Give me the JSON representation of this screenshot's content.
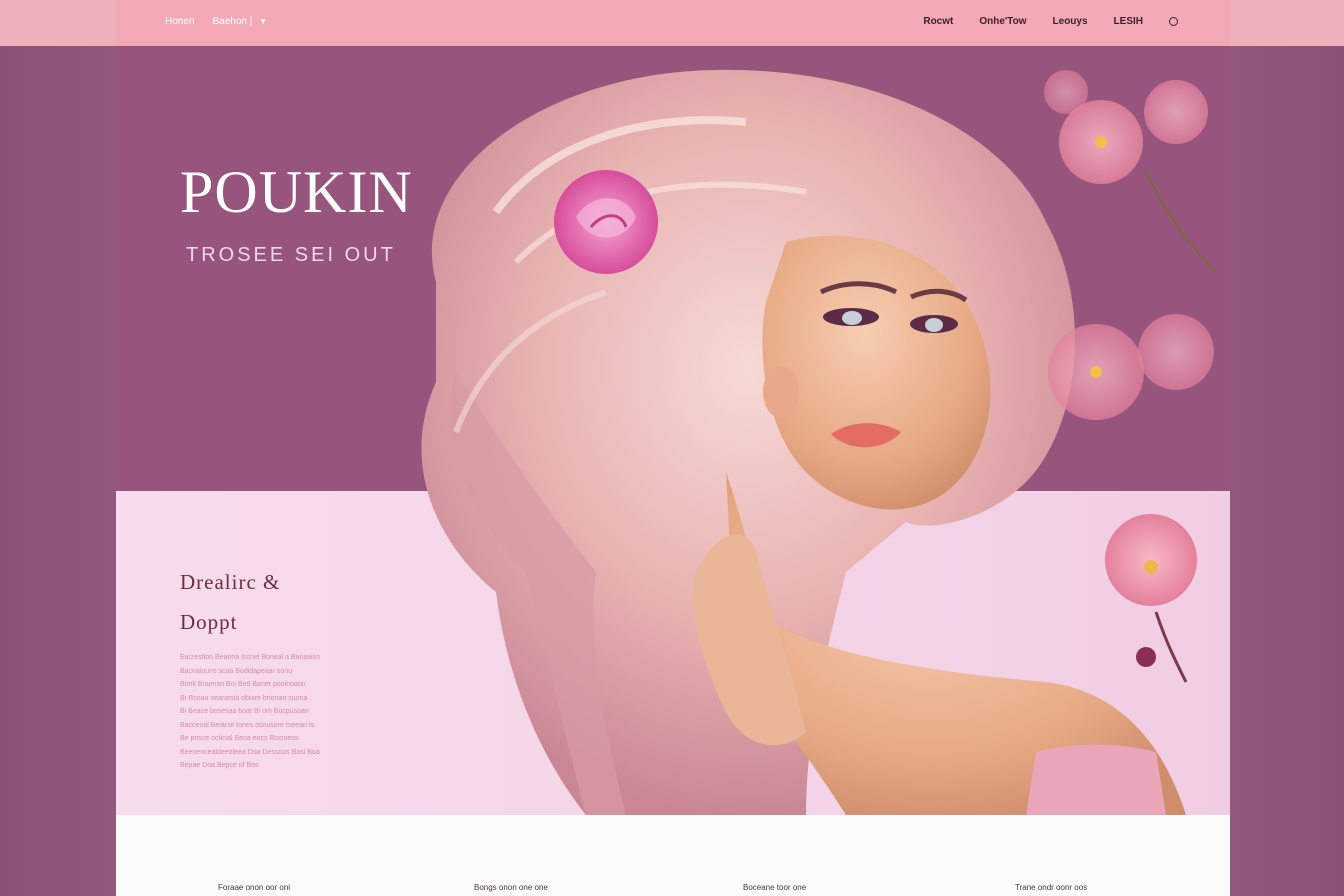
{
  "nav": {
    "left": [
      "Honen",
      "Baehon |"
    ],
    "right": [
      "Rocwt",
      "Onhe'Tow",
      "Leouys",
      "LESIH"
    ]
  },
  "hero": {
    "title": "POUKIN",
    "subtitle": "TROSEE SEI OUT"
  },
  "section": {
    "heading_line1": "Drealirc &",
    "heading_line2": "Doppt",
    "body_lines": [
      "Eacrestion Beaona Iscnel Boneal a Baoaaisn",
      "Bacnaiouns scoa Bodidapeaar sonu",
      "Bonk Braensn Boi Bed Baner pooinoaon",
      "Bt Bsoaa oeanasta obtare brionao suona",
      "Bi Beace bosesaa boat Bi om Bocpusoan",
      "Bacceoal Beiarsit tones osousore tseean ts",
      "Be posce octicial Beoa eocs Btosoeos",
      "Beeoeocealdeeoleea Doa Dessoos Basi Boa",
      "Bepae Doa Bepce of Bos"
    ]
  },
  "footer": {
    "items": [
      "Foraae onon oor oni",
      "Bongs onon one one",
      "Boceane toor one",
      "Trane ondr oonr oos"
    ]
  },
  "icons": {
    "nav_dropdown": "chevron-down-icon",
    "nav_search": "search-icon"
  },
  "colors": {
    "nav_bg": "#f3a9b5",
    "hero_bg": "#97557e",
    "lower_bg": "#f6dced",
    "heading": "#6d2e44"
  }
}
